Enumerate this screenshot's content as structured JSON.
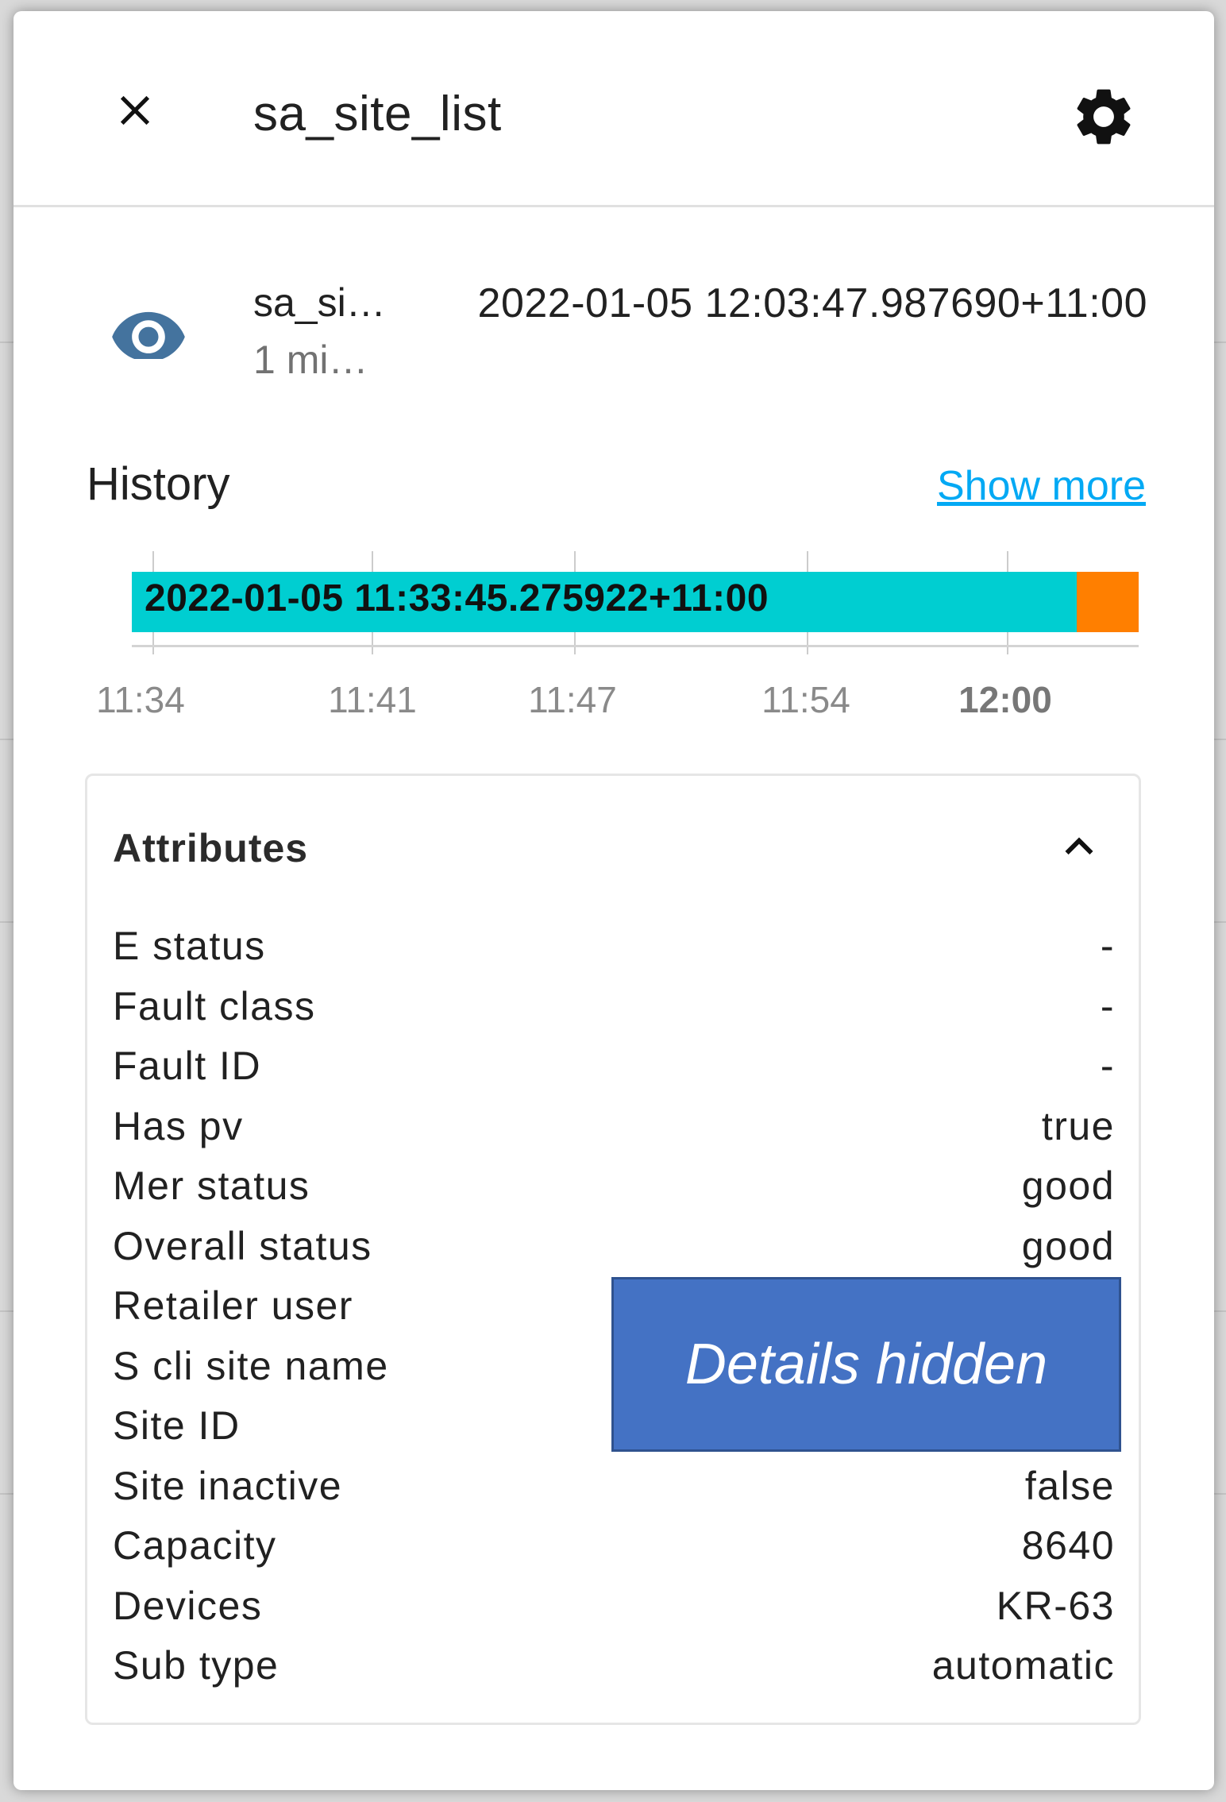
{
  "dialog": {
    "title": "sa_site_list",
    "close_icon": "close-icon",
    "settings_icon": "gear-icon"
  },
  "state": {
    "icon": "eye-icon",
    "name": "sa_si…",
    "last_changed": "1 mi…",
    "value": "2022-01-05 12:03:47.987690+11:00",
    "icon_color": "#44739e"
  },
  "history": {
    "title": "History",
    "show_more": "Show more",
    "show_more_color": "#03a9f4",
    "bar_label": "2022-01-05 11:33:45.275922+11:00",
    "bar_color": "#00ced1",
    "bar_end_color": "#ff7f00",
    "ticks": [
      {
        "label": "11:34"
      },
      {
        "label": "11:41"
      },
      {
        "label": "11:47"
      },
      {
        "label": "11:54"
      },
      {
        "label": "12:00"
      }
    ]
  },
  "attributes": {
    "title": "Attributes",
    "chevron_icon": "chevron-up-icon",
    "rows": [
      {
        "key": "E status",
        "value": "-"
      },
      {
        "key": "Fault class",
        "value": "-"
      },
      {
        "key": "Fault ID",
        "value": "-"
      },
      {
        "key": "Has pv",
        "value": "true"
      },
      {
        "key": "Mer status",
        "value": "good"
      },
      {
        "key": "Overall status",
        "value": "good"
      },
      {
        "key": "Retailer user",
        "value": ""
      },
      {
        "key": "S cli site name",
        "value": ""
      },
      {
        "key": "Site ID",
        "value": ""
      },
      {
        "key": "Site inactive",
        "value": "false"
      },
      {
        "key": "Capacity",
        "value": "8640"
      },
      {
        "key": "Devices",
        "value": "KR-63"
      },
      {
        "key": "Sub type",
        "value": "automatic"
      }
    ]
  },
  "redaction": {
    "label": "Details hidden",
    "color": "#4472c4"
  }
}
